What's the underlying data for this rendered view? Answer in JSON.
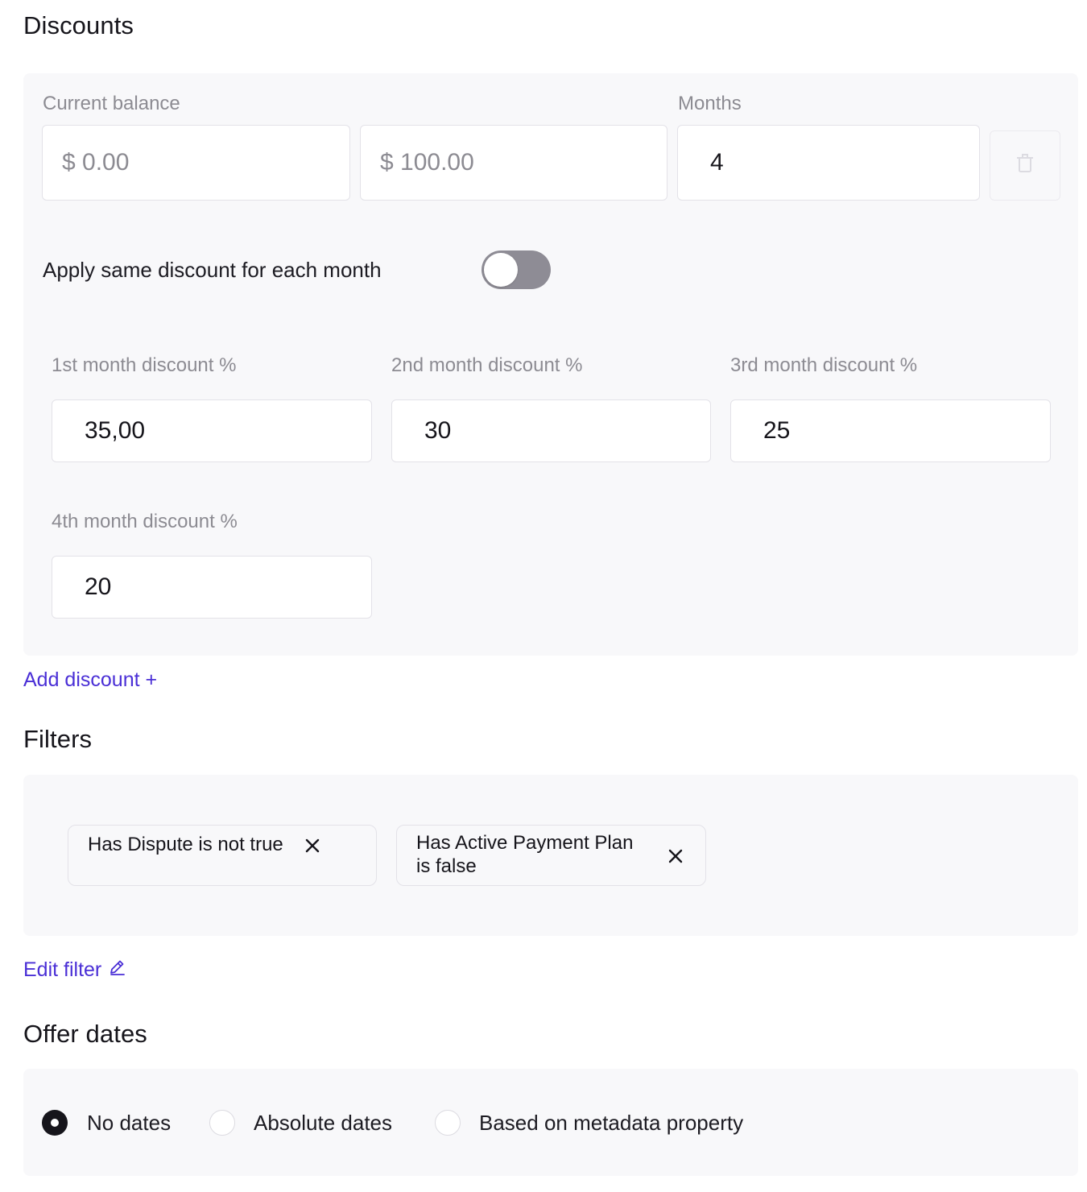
{
  "discounts": {
    "title": "Discounts",
    "current_balance_label": "Current balance",
    "balance_min_value": "$ 0.00",
    "balance_max_value": "$ 100.00",
    "months_label": "Months",
    "months_value": "4",
    "delete_icon": "trash-icon",
    "same_discount_label": "Apply same discount for each month",
    "same_discount_enabled": false,
    "month_discounts": [
      {
        "label": "1st month discount %",
        "value": "35,00"
      },
      {
        "label": "2nd month discount %",
        "value": "30"
      },
      {
        "label": "3rd month discount %",
        "value": "25"
      },
      {
        "label": "4th month discount %",
        "value": "20"
      }
    ],
    "add_discount_label": "Add discount +"
  },
  "filters": {
    "title": "Filters",
    "chips": [
      {
        "text": "Has Dispute is not true"
      },
      {
        "text_line1": "Has Active Payment Plan",
        "text_line2": "is false"
      }
    ],
    "close_icon": "close-icon",
    "edit_filter_label": "Edit filter",
    "edit_icon": "pencil-icon"
  },
  "offer_dates": {
    "title": "Offer dates",
    "options": [
      {
        "label": "No dates",
        "selected": true
      },
      {
        "label": "Absolute dates",
        "selected": false
      },
      {
        "label": "Based on metadata property",
        "selected": false
      }
    ]
  },
  "colors": {
    "accent_link": "#4a2fd6",
    "panel_bg": "#f8f8fa",
    "toggle_off": "#8e8c95",
    "muted_text": "#8c8b92"
  }
}
